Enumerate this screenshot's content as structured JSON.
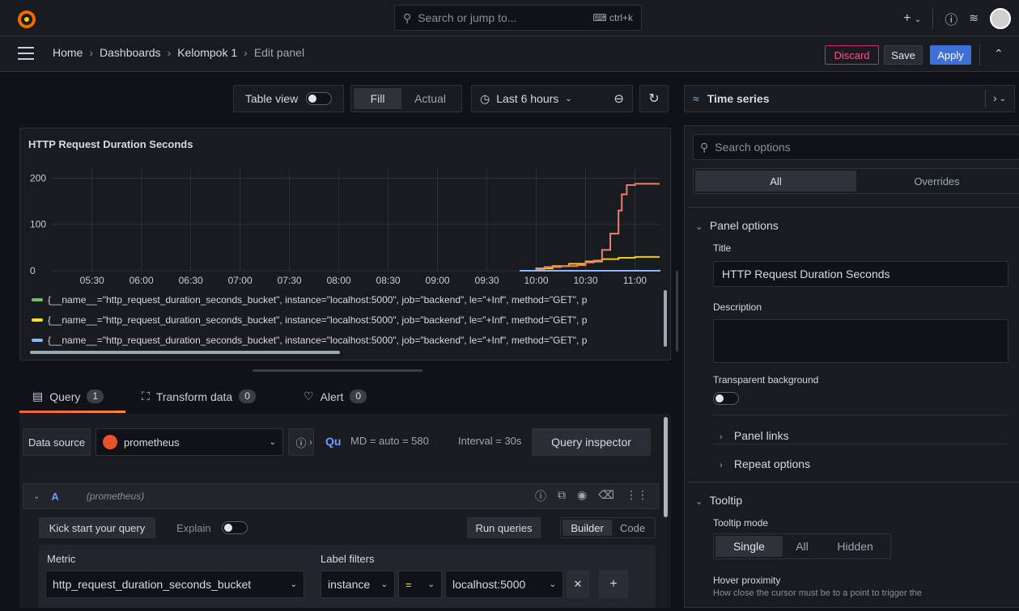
{
  "topbar": {
    "search_placeholder": "Search or jump to...",
    "search_shortcut": "ctrl+k",
    "new_label": "+"
  },
  "nav": {
    "breadcrumbs": [
      "Home",
      "Dashboards",
      "Kelompok 1",
      "Edit panel"
    ],
    "discard": "Discard",
    "save": "Save",
    "apply": "Apply"
  },
  "toolbar": {
    "table_view": "Table view",
    "fill": "Fill",
    "actual": "Actual",
    "time_range": "Last 6 hours"
  },
  "panel": {
    "title": "HTTP Request Duration Seconds",
    "legend": [
      {
        "label": "{__name__=\"http_request_duration_seconds_bucket\", instance=\"localhost:5000\", job=\"backend\", le=\"+Inf\", method=\"GET\", p",
        "color": "#73bf69"
      },
      {
        "label": "{__name__=\"http_request_duration_seconds_bucket\", instance=\"localhost:5000\", job=\"backend\", le=\"+Inf\", method=\"GET\", p",
        "color": "#fade2a"
      },
      {
        "label": "{__name__=\"http_request_duration_seconds_bucket\", instance=\"localhost:5000\", job=\"backend\", le=\"+Inf\", method=\"GET\", p",
        "color": "#8ab8ff"
      }
    ]
  },
  "chart_data": {
    "type": "line",
    "title": "HTTP Request Duration Seconds",
    "x_ticks": [
      "05:30",
      "06:00",
      "06:30",
      "07:00",
      "07:30",
      "08:00",
      "08:30",
      "09:00",
      "09:30",
      "10:00",
      "10:30",
      "11:00"
    ],
    "y_ticks": [
      0,
      100,
      200
    ],
    "ylim": [
      0,
      220
    ],
    "xlim": [
      "05:10",
      "11:15"
    ],
    "grid": true,
    "legend_position": "bottom",
    "series": [
      {
        "color": "#f2cc0c",
        "x": [
          "09:50",
          "10:00",
          "10:10",
          "10:20",
          "10:30",
          "10:40",
          "10:50",
          "11:00",
          "11:10",
          "11:15"
        ],
        "values": [
          0,
          5,
          10,
          15,
          20,
          25,
          28,
          30,
          30,
          30
        ]
      },
      {
        "color": "#f07c6e",
        "x": [
          "09:55",
          "10:00",
          "10:05",
          "10:15",
          "10:25",
          "10:30",
          "10:35",
          "10:40",
          "10:45",
          "10:50",
          "10:52",
          "10:55",
          "11:00",
          "11:15"
        ],
        "values": [
          0,
          3,
          8,
          10,
          12,
          18,
          22,
          45,
          80,
          130,
          165,
          185,
          188,
          188
        ]
      },
      {
        "color": "#8ab8ff",
        "x": [
          "09:50",
          "10:30",
          "11:15"
        ],
        "values": [
          0,
          0,
          2
        ]
      }
    ]
  },
  "tabs": [
    {
      "label": "Query",
      "count": "1"
    },
    {
      "label": "Transform data",
      "count": "0"
    },
    {
      "label": "Alert",
      "count": "0"
    }
  ],
  "query": {
    "data_source_label": "Data source",
    "data_source": "prometheus",
    "qu": "Qu",
    "md": "MD = auto = 580",
    "interval": "Interval = 30s",
    "inspector": "Query inspector",
    "row_letter": "A",
    "row_source": "(prometheus)",
    "kick_start": "Kick start your query",
    "explain": "Explain",
    "run_queries": "Run queries",
    "builder": "Builder",
    "code": "Code",
    "metric_label": "Metric",
    "metric_value": "http_request_duration_seconds_bucket",
    "label_filters_label": "Label filters",
    "filter_key": "instance",
    "filter_op": "=",
    "filter_value": "localhost:5000"
  },
  "options": {
    "viz": "Time series",
    "search_placeholder": "Search options",
    "tab_all": "All",
    "tab_overrides": "Overrides",
    "panel_options": "Panel options",
    "title_label": "Title",
    "title_value": "HTTP Request Duration Seconds",
    "description_label": "Description",
    "transparent_label": "Transparent background",
    "panel_links": "Panel links",
    "repeat_options": "Repeat options",
    "tooltip": "Tooltip",
    "tooltip_mode": "Tooltip mode",
    "mode_single": "Single",
    "mode_all": "All",
    "mode_hidden": "Hidden",
    "hover_proximity": "Hover proximity",
    "hover_desc": "How close the cursor must be to a point to trigger the"
  }
}
